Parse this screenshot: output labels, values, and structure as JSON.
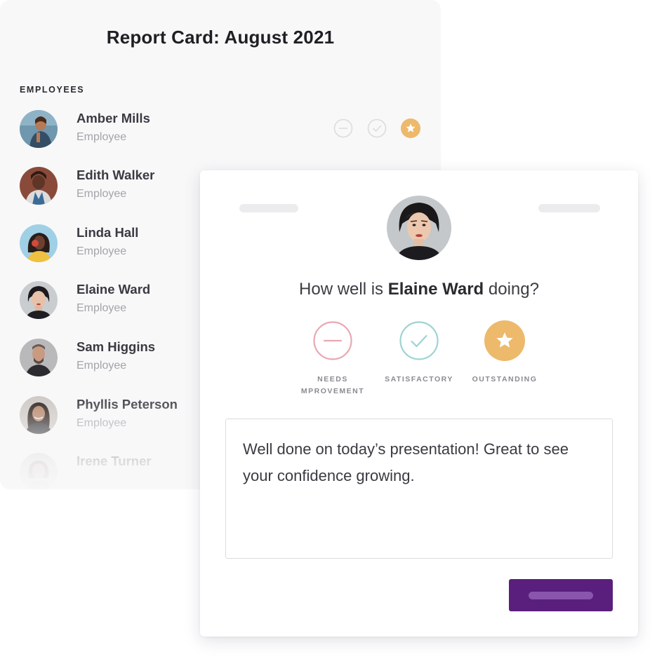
{
  "report": {
    "title": "Report Card: August 2021",
    "section_label": "EMPLOYEES",
    "employees": [
      {
        "name": "Amber Mills",
        "role": "Employee",
        "rating": "outstanding"
      },
      {
        "name": "Edith Walker",
        "role": "Employee"
      },
      {
        "name": "Linda Hall",
        "role": "Employee"
      },
      {
        "name": "Elaine Ward",
        "role": "Employee"
      },
      {
        "name": "Sam Higgins",
        "role": "Employee"
      },
      {
        "name": "Phyllis Peterson",
        "role": "Employee"
      },
      {
        "name": "Irene Turner",
        "role": ""
      }
    ]
  },
  "review": {
    "question_prefix": "How well is ",
    "employee_name": "Elaine Ward",
    "question_suffix": " doing?",
    "options": [
      {
        "id": "needs-improvement",
        "label_line1": "NEEDS",
        "label_line2": "MPROVEMENT",
        "icon": "minus-icon",
        "color": "#e8a9b3"
      },
      {
        "id": "satisfactory",
        "label_line1": "SATISFACTORY",
        "label_line2": "",
        "icon": "check-icon",
        "color": "#9fd3d3"
      },
      {
        "id": "outstanding",
        "label_line1": "OUTSTANDING",
        "label_line2": "",
        "icon": "star-icon",
        "color": "#edb96b",
        "selected": true
      }
    ],
    "comment": "Well done on today’s presentation! Great to see your confidence growing."
  },
  "colors": {
    "accent": "#5a1f7d",
    "outstanding": "#edb96b",
    "satisfactory": "#9fd3d3",
    "needs_improvement": "#e8a9b3"
  }
}
